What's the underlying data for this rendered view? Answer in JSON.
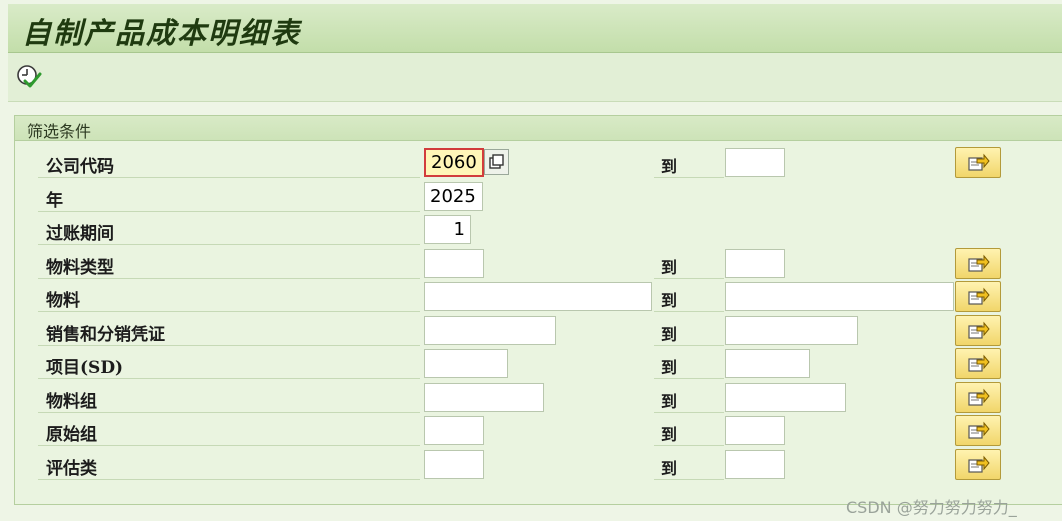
{
  "title": "自制产品成本明细表",
  "toolbar": {
    "execute_icon": "clock-check-icon"
  },
  "group": {
    "title": "筛选条件"
  },
  "to_label": "到",
  "fields": [
    {
      "label": "公司代码",
      "value": "2060",
      "to_value": "",
      "has_range": true
    },
    {
      "label": "年",
      "value": "2025",
      "has_range": false
    },
    {
      "label": "过账期间",
      "value": "1",
      "has_range": false
    },
    {
      "label": "物料类型",
      "value": "",
      "to_value": "",
      "has_range": true
    },
    {
      "label": "物料",
      "value": "",
      "to_value": "",
      "has_range": true
    },
    {
      "label": "销售和分销凭证",
      "value": "",
      "to_value": "",
      "has_range": true
    },
    {
      "label": "项目(SD)",
      "value": "",
      "to_value": "",
      "has_range": true
    },
    {
      "label": "物料组",
      "value": "",
      "to_value": "",
      "has_range": true
    },
    {
      "label": "原始组",
      "value": "",
      "to_value": "",
      "has_range": true
    },
    {
      "label": "评估类",
      "value": "",
      "to_value": "",
      "has_range": true
    }
  ],
  "watermark": "CSDN @努力努力努力_"
}
